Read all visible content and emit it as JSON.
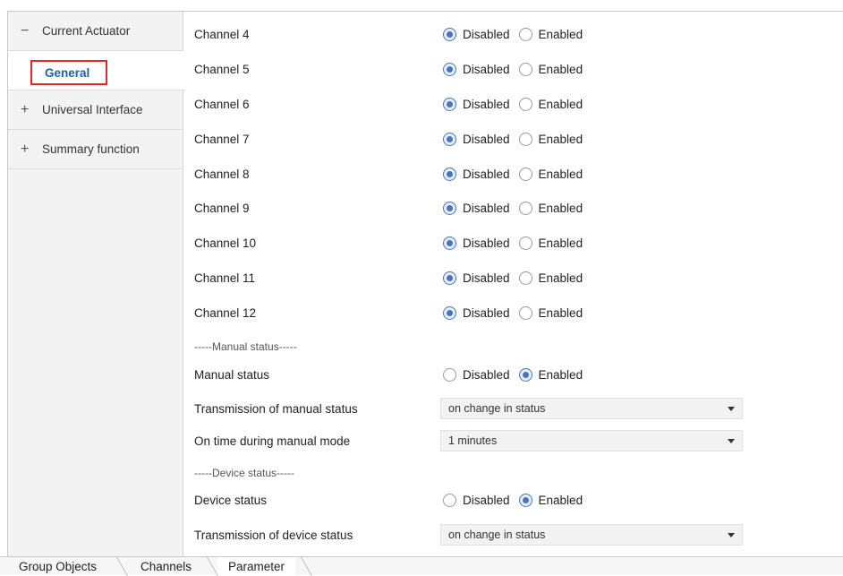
{
  "sidebar": {
    "nodes": [
      {
        "label": "Current Actuator",
        "sign": "−"
      },
      {
        "label": "Universal Interface",
        "sign": "+"
      },
      {
        "label": "Summary function",
        "sign": "+"
      }
    ],
    "selected_child": "General"
  },
  "radio_labels": {
    "disabled": "Disabled",
    "enabled": "Enabled"
  },
  "channels": [
    {
      "label": "Channel 4",
      "value": "Disabled"
    },
    {
      "label": "Channel 5",
      "value": "Disabled"
    },
    {
      "label": "Channel 6",
      "value": "Disabled"
    },
    {
      "label": "Channel 7",
      "value": "Disabled"
    },
    {
      "label": "Channel 8",
      "value": "Disabled"
    },
    {
      "label": "Channel 9",
      "value": "Disabled"
    },
    {
      "label": "Channel 10",
      "value": "Disabled"
    },
    {
      "label": "Channel 11",
      "value": "Disabled"
    },
    {
      "label": "Channel 12",
      "value": "Disabled"
    }
  ],
  "manual": {
    "separator": "-----Manual status-----",
    "status_label": "Manual status",
    "status_value": "Enabled",
    "transmission_label": "Transmission of manual status",
    "transmission_value": "on change in status",
    "ontime_label": "On time during manual mode",
    "ontime_value": "1 minutes"
  },
  "device": {
    "separator": "-----Device status-----",
    "status_label": "Device status",
    "status_value": "Enabled",
    "transmission_label": "Transmission of device status",
    "transmission_value": "on change in status"
  },
  "tabs": [
    "Group Objects",
    "Channels",
    "Parameter"
  ],
  "active_tab": "Parameter",
  "colors": {
    "accent": "#4a76b8",
    "highlight_border": "#e02a2a",
    "selected_text": "#1f5fa8"
  }
}
